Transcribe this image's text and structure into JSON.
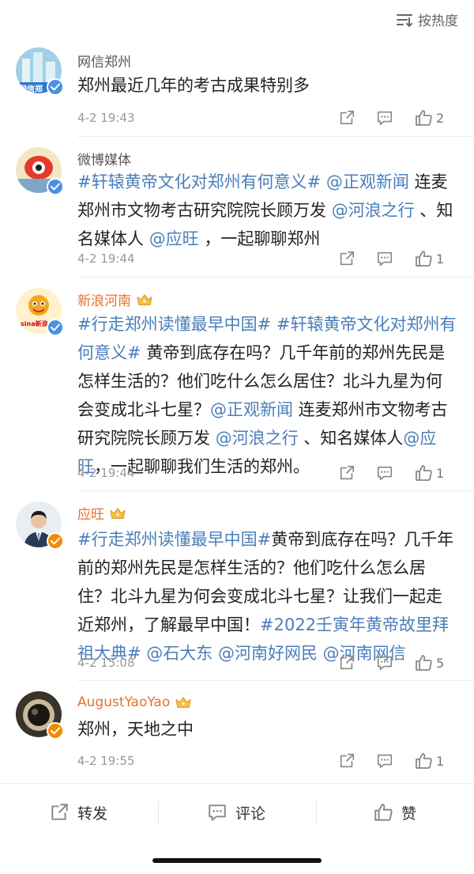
{
  "sort": {
    "label": "按热度",
    "icon": "sort-icon"
  },
  "comments": [
    {
      "username": "网信郑州",
      "avatar_text": "网信郑",
      "verified": "blue",
      "text_parts": [
        {
          "t": "郑州最近几年的考古成果特别多"
        }
      ],
      "time": "4-2 19:43",
      "likes": "2"
    },
    {
      "username": "微博媒体",
      "verified": "blue",
      "text_parts": [
        {
          "t": "#轩辕黄帝文化对郑州有何意义#",
          "c": "topic"
        },
        {
          "t": " "
        },
        {
          "t": "@正观新闻",
          "c": "mention"
        },
        {
          "t": " 连麦郑州市文物考古研究院院长顾万发 "
        },
        {
          "t": "@河浪之行",
          "c": "mention"
        },
        {
          "t": " 、知名媒体人 "
        },
        {
          "t": "@应旺",
          "c": "mention"
        },
        {
          "t": " ，一起聊聊郑州"
        }
      ],
      "time": "4-2 19:44",
      "likes": "1"
    },
    {
      "username": "新浪河南",
      "avatar_text": "sina新浪",
      "verified": "blue",
      "text_parts": [
        {
          "t": "#行走郑州读懂最早中国#",
          "c": "topic"
        },
        {
          "t": " "
        },
        {
          "t": "#轩辕黄帝文化对郑州有何意义#",
          "c": "topic"
        },
        {
          "t": " 黄帝到底存在吗？几千年前的郑州先民是怎样生活的？他们吃什么怎么居住？北斗九星为何会变成北斗七星？"
        },
        {
          "t": "@正观新闻",
          "c": "mention"
        },
        {
          "t": " 连麦郑州市文物考古研究院院长顾万发 "
        },
        {
          "t": "@河浪之行",
          "c": "mention"
        },
        {
          "t": " 、知名媒体人"
        },
        {
          "t": "@应旺",
          "c": "mention"
        },
        {
          "t": "，一起聊聊我们生活的郑州。"
        }
      ],
      "time": "4-2 19:44",
      "likes": "1"
    },
    {
      "username": "应旺",
      "verified": "orange",
      "text_parts": [
        {
          "t": "#行走郑州读懂最早中国#",
          "c": "topic"
        },
        {
          "t": "黄帝到底存在吗？几千年前的郑州先民是怎样生活的？他们吃什么怎么居住？北斗九星为何会变成北斗七星？让我们一起走近郑州，了解最早中国！"
        },
        {
          "t": "#2022壬寅年黄帝故里拜祖大典#",
          "c": "topic"
        },
        {
          "t": " "
        },
        {
          "t": "@石大东",
          "c": "mention"
        },
        {
          "t": " "
        },
        {
          "t": "@河南好网民",
          "c": "mention"
        },
        {
          "t": " "
        },
        {
          "t": "@河南网信",
          "c": "mention"
        }
      ],
      "time": "4-2 15:08",
      "likes": "5"
    },
    {
      "username": "AugustYaoYao",
      "verified": "orange",
      "text_parts": [
        {
          "t": "郑州，天地之中"
        }
      ],
      "time": "4-2 19:55",
      "likes": "1"
    }
  ],
  "bottom_bar": {
    "repost": "转发",
    "comment": "评论",
    "like": "赞"
  },
  "colors": {
    "link": "#4a7eb8",
    "orange_name": "#e7722b",
    "verify_blue": "#4a90e2",
    "verify_orange": "#f08c00"
  }
}
